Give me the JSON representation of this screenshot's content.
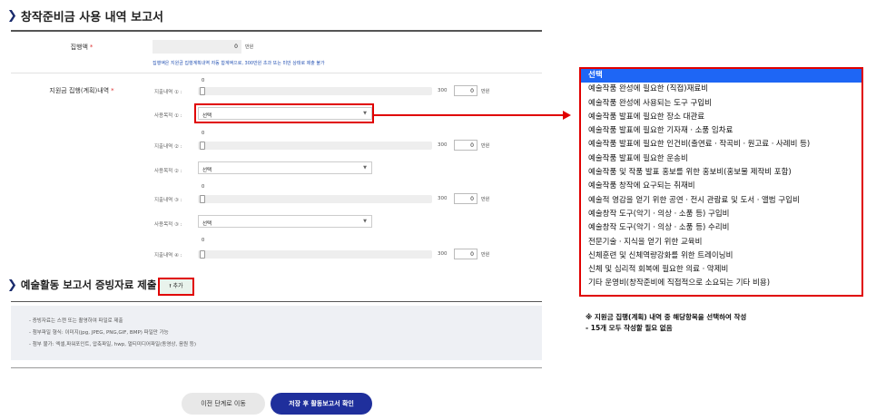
{
  "section1": {
    "title": "창작준비금 사용 내역 보고서"
  },
  "amount": {
    "label": "집행액",
    "required_mark": "*",
    "value": "0",
    "unit": "만원",
    "note": "집행액은 지원금 집행계획내역 자동 합계액으로, 300만원 초과 또는 미만 상태로 제출 불가"
  },
  "plan": {
    "label": "지원금 집행(계획)내역",
    "required_mark": "*",
    "max": "300",
    "unit": "만원",
    "rows": [
      {
        "expense_label": "지출내역 ①  :",
        "slider_value": "0",
        "amount": "0",
        "purpose_label": "사용목적 ①  :",
        "purpose_value": "선택"
      },
      {
        "expense_label": "지출내역 ②  :",
        "slider_value": "0",
        "amount": "0",
        "purpose_label": "사용목적 ②  :",
        "purpose_value": "선택"
      },
      {
        "expense_label": "지출내역 ③  :",
        "slider_value": "0",
        "amount": "0",
        "purpose_label": "사용목적 ③  :",
        "purpose_value": "선택"
      },
      {
        "expense_label": "지출내역 ④  :",
        "slider_value": "0",
        "amount": "0"
      }
    ]
  },
  "dropdown": {
    "options": [
      "선택",
      "예술작품 완성에 필요한 (직접)재료비",
      "예술작품 완성에 사용되는 도구 구입비",
      "예술작품 발표에 필요한 장소 대관료",
      "예술작품 발표에 필요한 기자재ㆍ소품 임차료",
      "예술작품 발표에 필요한 인건비(출연료ㆍ작곡비ㆍ원고료ㆍ사례비 등)",
      "예술작품 발표에 필요한 운송비",
      "예술작품 및 작품 발표 홍보를 위한 홍보비(홍보물 제작비 포함)",
      "예술작품 창작에 요구되는 취재비",
      "예술적 영감을 얻기 위한 공연ㆍ전시 관람료 및 도서ㆍ앨범 구입비",
      "예술창작 도구(악기ㆍ의상ㆍ소품 등) 구입비",
      "예술창작 도구(악기ㆍ의상ㆍ소품 등) 수리비",
      "전문기술ㆍ지식을 얻기 위한 교육비",
      "신체훈련 및 신체역량강화를 위한 트레이닝비",
      "신체 및 심리적 회복에 필요한 의료ㆍ약제비",
      "기타 운영비(창작준비에 직접적으로 소요되는 기타 비용)"
    ]
  },
  "annotation": {
    "line1": "※ 지원금 집행(계획) 내역 중 해당항목을 선택하여 작성",
    "line2": "- 15개 모두 작성할 필요 없음"
  },
  "section2": {
    "title": "예술활동 보고서 증빙자료 제출",
    "add_label": "추가",
    "info": [
      "- 증빙자료는 스캔 또는 촬영하여 파일로 제출",
      "- 첨부파일 형식: 이미지(jpg, JPEG, PNG,GIF, BMP) 파일만 가능",
      "- 첨부 불가: 엑셀,파워포인트, 압축파일, hwp, 멀티미디어파일(동영상, 음원 등)"
    ]
  },
  "buttons": {
    "prev": "이전 단계로 이동",
    "save": "저장 후 활동보고서 확인"
  },
  "icons": {
    "section": "chevron-right-icon",
    "upload": "upload-icon",
    "caret": "caret-down-icon"
  },
  "colors": {
    "accent": "#1f2f9c",
    "highlight": "#e00000",
    "selected": "#1e66f5"
  }
}
